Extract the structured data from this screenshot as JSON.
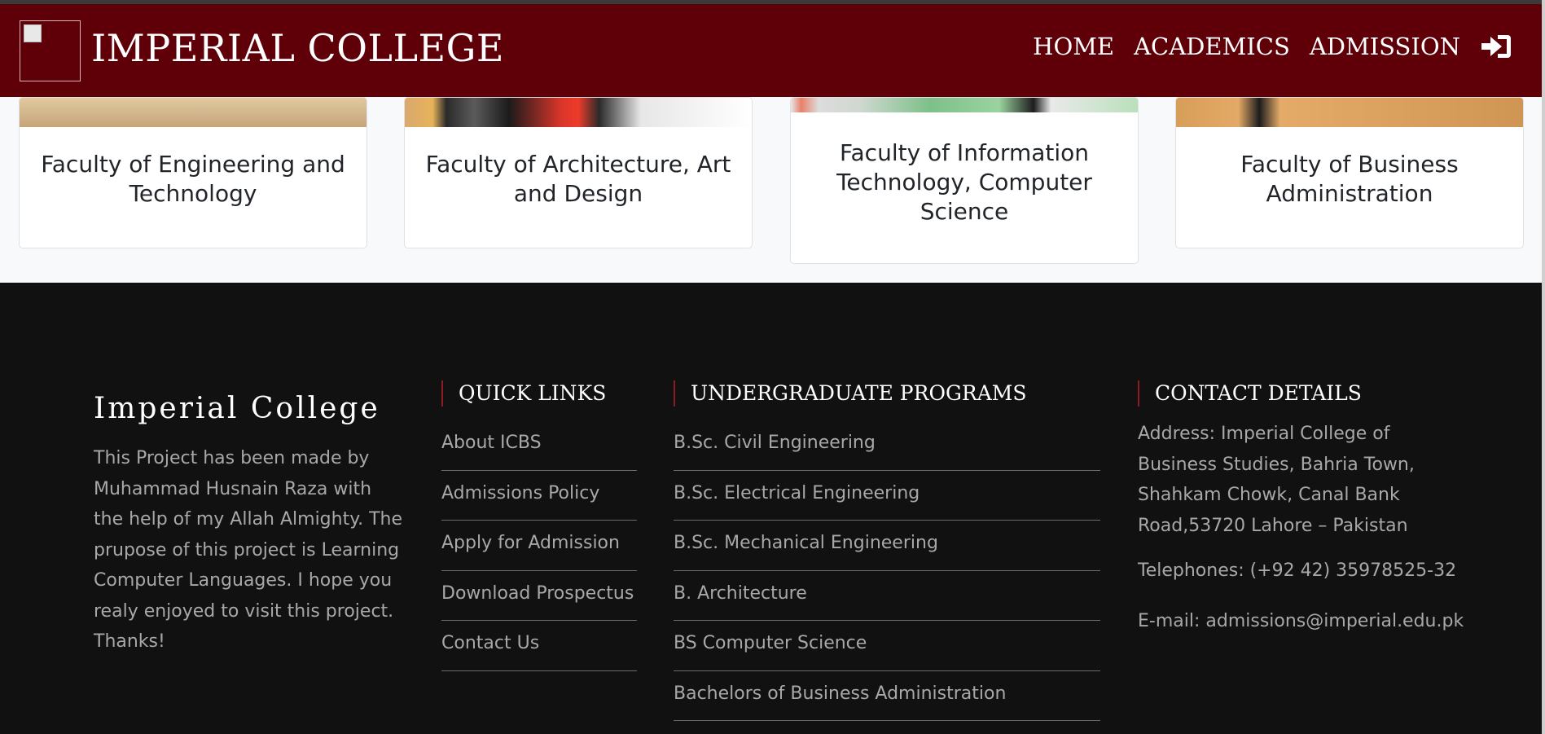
{
  "navbar": {
    "brand": "IMPERIAL COLLEGE",
    "links": [
      "HOME",
      "ACADEMICS",
      "ADMISSION"
    ],
    "login_icon": "sign-in-icon",
    "background_color": "#5f0009"
  },
  "faculties": [
    {
      "title": "Faculty of Engineering and Technology"
    },
    {
      "title": "Faculty of Architecture, Art and Design"
    },
    {
      "title": "Faculty of Information Technology, Computer Science"
    },
    {
      "title": "Faculty of Business Administration"
    }
  ],
  "footer": {
    "about": {
      "title": "Imperial College",
      "text": "This Project has been made by Muhammad Husnain Raza with the help of my Allah Almighty. The prupose of this project is Learning Computer Languages. I hope you realy enjoyed to visit this project. Thanks!"
    },
    "quick_links": {
      "heading": "QUICK LINKS",
      "items": [
        "About ICBS",
        "Admissions Policy",
        "Apply for Admission",
        "Download Prospectus",
        "Contact Us"
      ]
    },
    "programs": {
      "heading": "UNDERGRADUATE PROGRAMS",
      "items": [
        "B.Sc. Civil Engineering",
        "B.Sc. Electrical Engineering",
        "B.Sc. Mechanical Engineering",
        "B. Architecture",
        "BS Computer Science",
        "Bachelors of Business Administration"
      ]
    },
    "contact": {
      "heading": "CONTACT DETAILS",
      "address": "Address: Imperial College of Business Studies, Bahria Town, Shahkam Chowk, Canal Bank Road,53720 Lahore – Pakistan",
      "phone": "Telephones: (+92 42) 35978525-32",
      "email": "E-mail: admissions@imperial.edu.pk"
    },
    "background_color": "#111111",
    "accent_color": "#8c1d25"
  }
}
